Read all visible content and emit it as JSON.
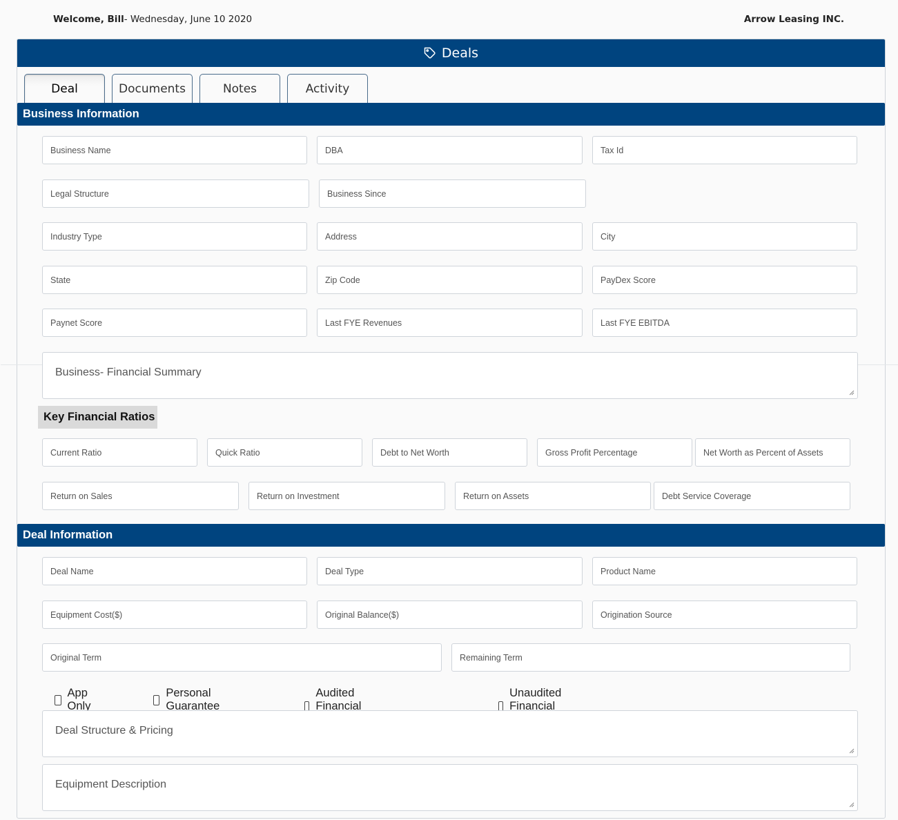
{
  "header": {
    "welcome_name": "Welcome, Bill",
    "welcome_date": "- Wednesday, June 10 2020",
    "company": "Arrow Leasing INC."
  },
  "panel": {
    "title": "Deals",
    "icon": "tag-icon"
  },
  "tabs": [
    {
      "label": "Deal",
      "active": true
    },
    {
      "label": "Documents",
      "active": false
    },
    {
      "label": "Notes",
      "active": false
    },
    {
      "label": "Activity",
      "active": false
    }
  ],
  "business_info": {
    "title": "Business Information",
    "fields": {
      "business_name": "Business Name",
      "dba": "DBA",
      "tax_id": "Tax Id",
      "legal_structure": "Legal Structure",
      "business_since": "Business Since",
      "industry_type": "Industry Type",
      "address": "Address",
      "city": "City",
      "state": "State",
      "zip_code": "Zip Code",
      "paydex_score": "PayDex Score",
      "paynet_score": "Paynet Score",
      "last_fye_revenues": "Last FYE Revenues",
      "last_fye_ebitda": "Last FYE EBITDA"
    },
    "financial_summary": "Business- Financial Summary"
  },
  "key_ratios": {
    "title": "Key Financial Ratios",
    "fields": {
      "current_ratio": "Current Ratio",
      "quick_ratio": "Quick Ratio",
      "debt_to_net_worth": "Debt to Net Worth",
      "gross_profit_percentage": "Gross Profit Percentage",
      "net_worth_percent_assets": "Net Worth as Percent of Assets",
      "return_on_sales": "Return on Sales",
      "return_on_investment": "Return on Investment",
      "return_on_assets": "Return on Assets",
      "debt_service_coverage": "Debt Service Coverage"
    }
  },
  "deal_info": {
    "title": "Deal Information",
    "fields": {
      "deal_name": "Deal Name",
      "deal_type": "Deal Type",
      "product_name": "Product Name",
      "equipment_cost": "Equipment Cost($)",
      "original_balance": "Original Balance($)",
      "origination_source": "Origination Source",
      "original_term": "Original Term",
      "remaining_term": "Remaining Term"
    },
    "checkboxes": {
      "app_only": {
        "label": "App Only",
        "checked": false
      },
      "personal_guarantee": {
        "label": "Personal Guarantee",
        "checked": false
      },
      "audited": {
        "label": "Audited Financial statements",
        "checked": false
      },
      "unaudited": {
        "label": "Unaudited Financial Statements",
        "checked": false
      }
    },
    "deal_structure": "Deal Structure & Pricing",
    "equipment_description": "Equipment Description"
  }
}
